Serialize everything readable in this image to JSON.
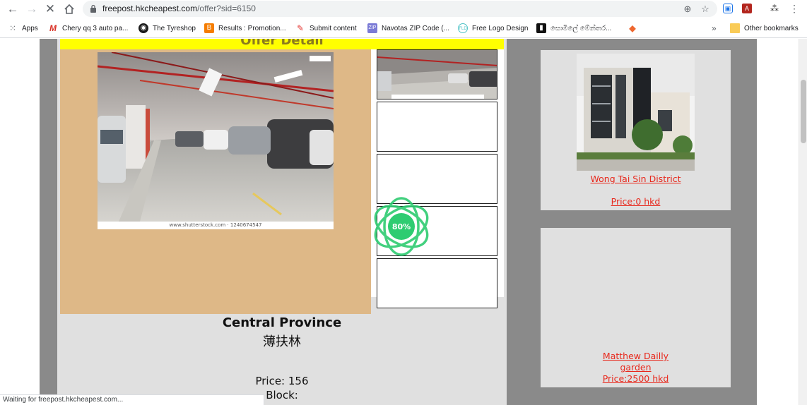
{
  "browser": {
    "url_host": "freepost.hkcheapest.com",
    "url_path": "/offer?sid=6150",
    "status_text": "Waiting for freepost.hkcheapest.com..."
  },
  "bookmarks": {
    "items": [
      {
        "label": "Apps",
        "icon": "apps-grid-icon",
        "color": "#5f6368"
      },
      {
        "label": "Chery qq 3 auto pa...",
        "icon": "m-logo-icon",
        "color": "#d93025"
      },
      {
        "label": "The Tyreshop",
        "icon": "tyreshop-icon",
        "color": "#1a1a1a"
      },
      {
        "label": "Results : Promotion...",
        "icon": "blogger-icon",
        "color": "#f57d00"
      },
      {
        "label": "Submit content",
        "icon": "submit-icon",
        "color": "#e53935"
      },
      {
        "label": "Navotas ZIP Code (...",
        "icon": "zip-icon",
        "color": "#7b7bd6"
      },
      {
        "label": "Free Logo Design",
        "icon": "logo-design-icon",
        "color": "#4fc3c7"
      },
      {
        "label": "සොමිලේ මේන්තර...",
        "icon": "bookmark-dark-icon",
        "color": "#111111"
      },
      {
        "label": "",
        "icon": "magento-icon",
        "color": "#ee672f"
      }
    ],
    "overflow_label": "»",
    "other_label": "Other bookmarks"
  },
  "offer": {
    "header_title": "Offer Detail",
    "photo_caption": "www.shutterstock.com · 1240674547",
    "location": "Central Province",
    "district_chinese": "薄扶林",
    "price_line": "Price: 156",
    "block_line": "Block:",
    "loader_percent": "80%"
  },
  "sidebar": {
    "cards": [
      {
        "district": "Wong Tai Sin District",
        "price": "Price:0 hkd"
      },
      {
        "name_line1": "Matthew Dailly",
        "name_line2": "garden",
        "price": "Price:2500 hkd"
      }
    ]
  },
  "colors": {
    "offer_header": "#ffff00",
    "tan_panel": "#deb887",
    "link_red": "#e8281c",
    "loader_green": "#2ecc71"
  }
}
